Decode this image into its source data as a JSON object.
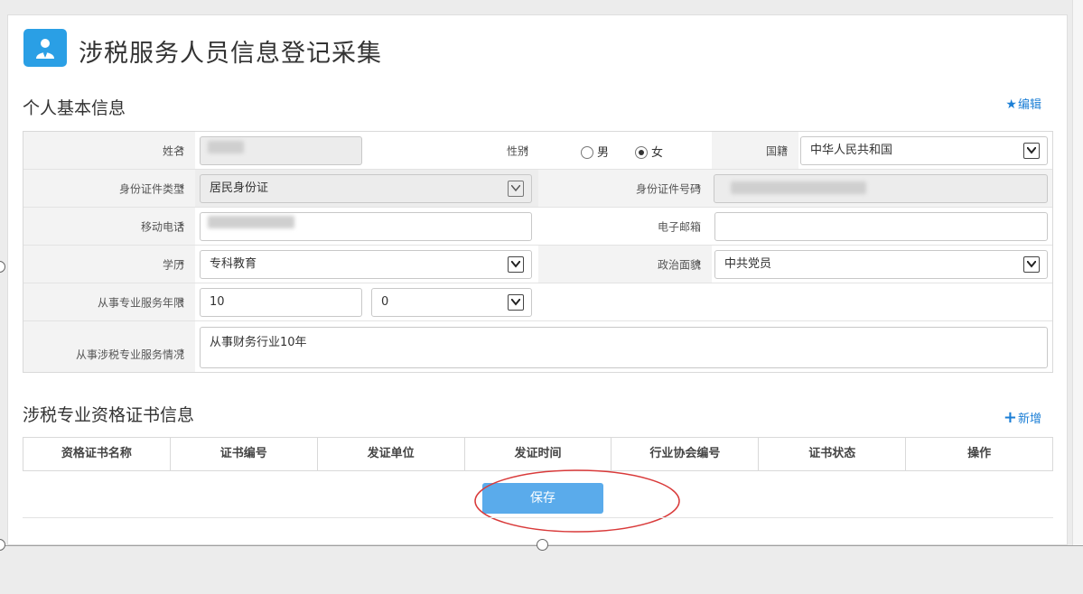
{
  "page": {
    "title": "涉税服务人员信息登记采集"
  },
  "basic_info": {
    "section_title": "个人基本信息",
    "edit_label": "编辑",
    "edit_symbol": "★",
    "fields": {
      "name_label": "姓名",
      "gender_label": "性别",
      "gender_options": [
        "男",
        "女"
      ],
      "gender_selected": "女",
      "nationality_label": "国籍",
      "nationality_value": "中华人民共和国",
      "id_type_label": "身份证件类型",
      "id_type_value": "居民身份证",
      "id_number_label": "身份证件号码",
      "mobile_label": "移动电话",
      "email_label": "电子邮箱",
      "education_label": "学历",
      "education_value": "专科教育",
      "political_label": "政治面貌",
      "political_value": "中共党员",
      "years_label": "从事专业服务年限",
      "years_value": "10",
      "months_value": "0",
      "service_desc_label": "从事涉税专业服务情况",
      "service_desc_value": "从事财务行业10年"
    },
    "required_mark": "*",
    "colon": ":"
  },
  "certificates": {
    "section_title": "涉税专业资格证书信息",
    "add_label": "新增",
    "add_symbol": "+",
    "columns": [
      "资格证书名称",
      "证书编号",
      "发证单位",
      "发证时间",
      "行业协会编号",
      "证书状态",
      "操作"
    ]
  },
  "actions": {
    "save_label": "保存"
  },
  "colors": {
    "accent": "#2a9fe5",
    "save_button": "#5aabeb",
    "required": "#e02020",
    "annotation": "#d93a3a"
  }
}
